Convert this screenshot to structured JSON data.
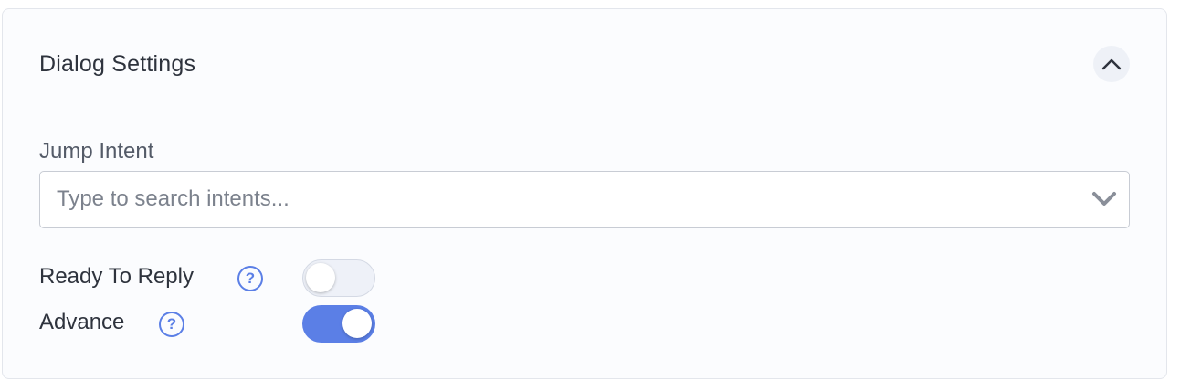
{
  "panel": {
    "title": "Dialog Settings",
    "collapse_icon": "chevron-up-icon"
  },
  "jump_intent": {
    "label": "Jump Intent",
    "value": "",
    "placeholder": "Type to search intents...",
    "dropdown_icon": "chevron-down-icon"
  },
  "ready_to_reply": {
    "label": "Ready To Reply",
    "help_icon": "question-circle-icon",
    "help_glyph": "?",
    "enabled": false
  },
  "advance": {
    "label": "Advance",
    "help_icon": "question-circle-icon",
    "help_glyph": "?",
    "enabled": true
  },
  "colors": {
    "accent": "#5b7fe6",
    "panel_bg": "#fbfcfe",
    "text": "#2e333d"
  }
}
